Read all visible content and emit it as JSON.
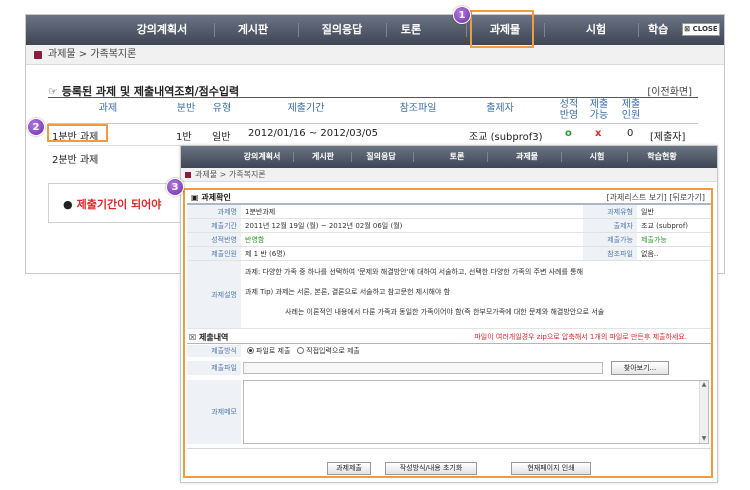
{
  "nav": {
    "tabs": [
      "강의계획서",
      "게시판",
      "질의응답",
      "토론",
      "과제물",
      "시험",
      "학습"
    ],
    "close_label": "CLOSE"
  },
  "breadcrumb": "과제물 > 가족복지론",
  "list": {
    "title": "등록된 과제 및 제출내역조회/점수입력",
    "prev_link": "[이전화면]",
    "headers": {
      "task": "과제",
      "group": "분반",
      "type": "유형",
      "period": "제출기간",
      "ref": "참조파일",
      "author": "출제자",
      "graded": "성적\n반영",
      "submittable": "제출\n가능",
      "count": "제출\n인원"
    },
    "rows": [
      {
        "task": "1분반 과제",
        "group": "1반",
        "type": "일반",
        "period": "2012/01/16 ~ 2012/03/05",
        "author": "조교 (subprof3)",
        "graded": "o",
        "submittable": "x",
        "count": "0",
        "action": "[제출자]"
      },
      {
        "task": "2분반 과제"
      }
    ],
    "notice": "제출기간이 되어야"
  },
  "popup": {
    "nav_tabs": [
      "강의계획서",
      "게시판",
      "질의응답",
      "토론",
      "과제물",
      "시험",
      "학습현황"
    ],
    "breadcrumb": "과제물 > 가족복지론",
    "title": "과제확인",
    "links": "[과제리스트 보기] [뒤로가기]",
    "info": {
      "name_label": "과제명",
      "name": "1분반과제",
      "type_label": "과제유형",
      "type": "일반",
      "period_label": "제출기간",
      "period": "2011년 12월 19일 (월) ~ 2012년 02월 06일 (월)",
      "author_label": "출제자",
      "author": "조교 (subprof)",
      "graded_label": "성적반영",
      "graded": "반영함",
      "submit_label": "제출가능",
      "submit": "제출가능",
      "group_label": "제출인원",
      "group": "제 1 반 (6명)",
      "ref_label": "참조파일",
      "ref": "없음..",
      "desc_label": "과제설명",
      "desc_lines": [
        "과제: 다양한 가족 중 하나를 선택하여 '문제와 해결방안'에 대하여 서술하고, 선택한 다양한 가족의 주변 사례를 통해",
        "과제 Tip) 과제는 서론, 본론, 결론으로 서술하고 참고문헌 제시해야 함",
        "사례는 이론적인 내용에서 다룬 가족과 동일한 가족이어야 함(즉 한부모가족에 대한 문제와 해결방안으로 서술"
      ]
    },
    "submission": {
      "title": "제출내역",
      "note": "파일이 여러개일경우 zip으로 압축해서 1개의 파일로 만든후 제출하세요.",
      "method_label": "제출방식",
      "method_file": "파일로 제출",
      "method_direct": "직접입력으로 제출",
      "file_label": "제출파일",
      "browse": "찾아보기...",
      "memo_label": "과제메모"
    },
    "buttons": [
      "과제제출",
      "작성방식/내용 초기화",
      "현재페이지 인쇄"
    ]
  },
  "badges": [
    "1",
    "2",
    "3"
  ],
  "colors": {
    "nav": "#4f5667",
    "highlight": "#f39a3a",
    "badge": "#7b3fb5",
    "accent_red": "#e0262a"
  }
}
